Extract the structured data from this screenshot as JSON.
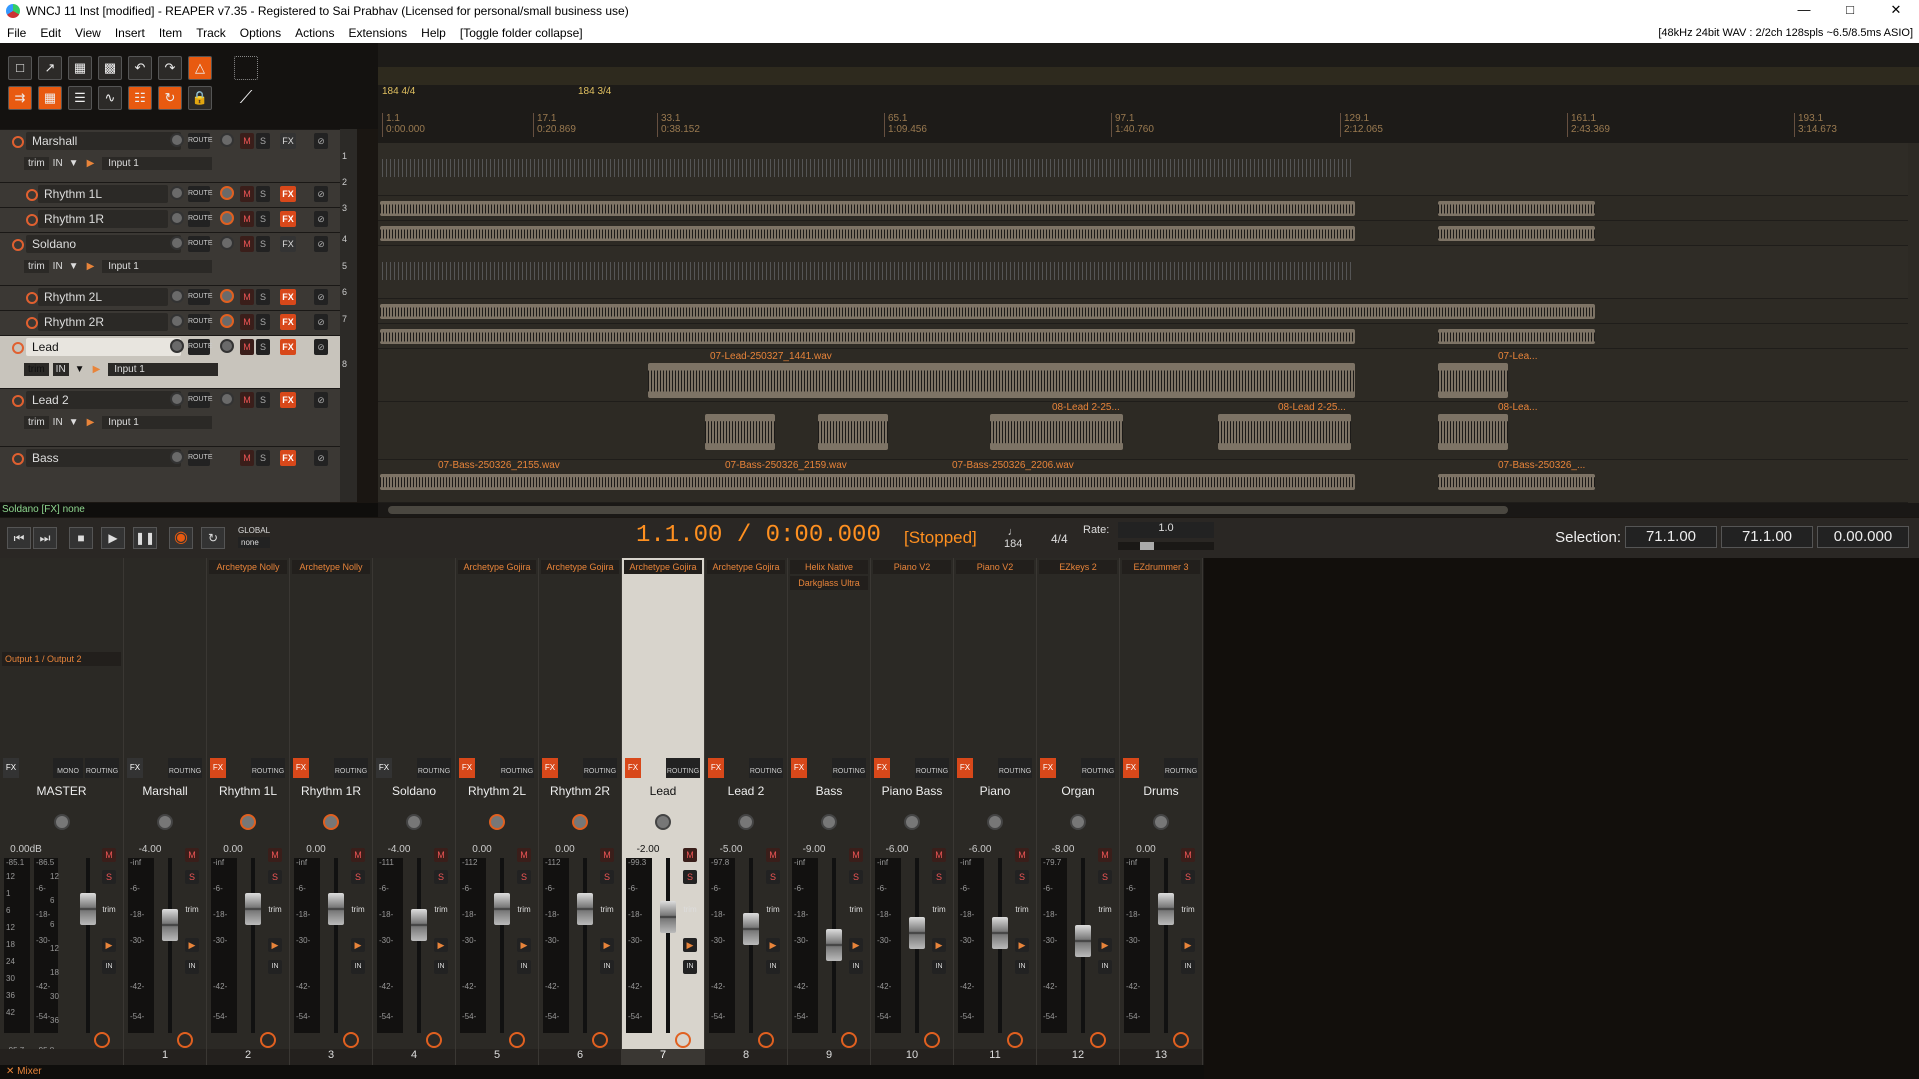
{
  "window": {
    "title": "WNCJ 11 Inst [modified] - REAPER v7.35 - Registered to Sai Prabhav (Licensed for personal/small business use)"
  },
  "menu": {
    "items": [
      "File",
      "Edit",
      "View",
      "Insert",
      "Item",
      "Track",
      "Options",
      "Actions",
      "Extensions",
      "Help",
      "[Toggle folder collapse]"
    ],
    "status": "[48kHz 24bit WAV : 2/2ch 128spls ~6.5/8.5ms ASIO]"
  },
  "ruler": {
    "regions": [
      "184 4/4",
      "184 3/4"
    ],
    "markers": [
      {
        "bar": "1.1",
        "time": "0:00.000"
      },
      {
        "bar": "17.1",
        "time": "0:20.869"
      },
      {
        "bar": "33.1",
        "time": "0:38.152"
      },
      {
        "bar": "65.1",
        "time": "1:09.456"
      },
      {
        "bar": "97.1",
        "time": "1:40.760"
      },
      {
        "bar": "129.1",
        "time": "2:12.065"
      },
      {
        "bar": "161.1",
        "time": "2:43.369"
      },
      {
        "bar": "193.1",
        "time": "3:14.673"
      }
    ]
  },
  "tracks": [
    {
      "name": "Marshall",
      "num": "1",
      "input": "Input 1"
    },
    {
      "name": "Rhythm 1L",
      "num": "2"
    },
    {
      "name": "Rhythm 1R",
      "num": "3"
    },
    {
      "name": "Soldano",
      "num": "4",
      "input": "Input 1"
    },
    {
      "name": "Rhythm 2L",
      "num": "5"
    },
    {
      "name": "Rhythm 2R",
      "num": "6"
    },
    {
      "name": "Lead",
      "num": "7",
      "input": "Input 1"
    },
    {
      "name": "Lead 2",
      "num": "8",
      "input": "Input 1"
    },
    {
      "name": "Bass",
      "num": "9"
    }
  ],
  "tcp_labels": {
    "trim": "trim",
    "in": "IN",
    "route": "ROUTE",
    "mute": "M",
    "solo": "S",
    "fx": "FX"
  },
  "items": {
    "lead": [
      "07-Lead-250327_1441.wav",
      "07-Lea..."
    ],
    "lead2": [
      "08-Lead 2-25...",
      "08-Lead 2-25...",
      "08-Lea..."
    ],
    "bass": [
      "07-Bass-250326_2155.wav",
      "07-Bass-250326_2159.wav",
      "07-Bass-250326_2206.wav",
      "07-Bass-250326_..."
    ]
  },
  "status": {
    "hover": "Soldano [FX] none"
  },
  "transport": {
    "global": "GLOBAL",
    "global_mode": "none",
    "position": "1.1.00 / 0:00.000",
    "state": "[Stopped]",
    "bpm": "184",
    "time_sig": "4/4",
    "rate_label": "Rate:",
    "rate_value": "1.0",
    "selection_label": "Selection:",
    "sel_start": "71.1.00",
    "sel_end": "71.1.00",
    "sel_len": "0.00.000"
  },
  "mixer": {
    "master_output": "Output 1 / Output 2",
    "tab_label": "Mixer",
    "fx_label": "FX",
    "routing_label": "ROUTING",
    "mono_label": "MONO",
    "trim_label": "trim",
    "in_label": "IN",
    "mute_label": "M",
    "solo_label": "S",
    "meter_marks": [
      "-6-",
      "-18-",
      "-30-",
      "-42-",
      "-54-"
    ],
    "master_left_marks": [
      "12",
      "1",
      "6",
      "12",
      "18",
      "24",
      "30",
      "36",
      "42"
    ],
    "master_right_marks": [
      "12",
      "6",
      "6",
      "12",
      "18",
      "30",
      "36"
    ],
    "master_peaks": {
      "top_l": "-85.1",
      "top_r": "-86.5",
      "bot_l": "-95.7",
      "bot_r": "-95.8"
    },
    "strips": [
      {
        "name": "MASTER",
        "num": "",
        "vol": "0.00dB",
        "peak": "",
        "fx": [],
        "fxon": false
      },
      {
        "name": "Marshall",
        "num": "1",
        "vol": "-4.00",
        "peak": "-inf",
        "fx": [],
        "fxon": false
      },
      {
        "name": "Rhythm 1L",
        "num": "2",
        "vol": "0.00",
        "peak": "-inf",
        "fx": [
          "Archetype Nolly"
        ],
        "fxon": true
      },
      {
        "name": "Rhythm 1R",
        "num": "3",
        "vol": "0.00",
        "peak": "-inf",
        "fx": [
          "Archetype Nolly"
        ],
        "fxon": true
      },
      {
        "name": "Soldano",
        "num": "4",
        "vol": "-4.00",
        "peak": "-111",
        "fx": [],
        "fxon": false
      },
      {
        "name": "Rhythm 2L",
        "num": "5",
        "vol": "0.00",
        "peak": "-112",
        "fx": [
          "Archetype Gojira"
        ],
        "fxon": true
      },
      {
        "name": "Rhythm 2R",
        "num": "6",
        "vol": "0.00",
        "peak": "-112",
        "fx": [
          "Archetype Gojira"
        ],
        "fxon": true
      },
      {
        "name": "Lead",
        "num": "7",
        "vol": "-2.00",
        "peak": "-99.3",
        "fx": [
          "Archetype Gojira"
        ],
        "fxon": true
      },
      {
        "name": "Lead 2",
        "num": "8",
        "vol": "-5.00",
        "peak": "-97.8",
        "fx": [
          "Archetype Gojira"
        ],
        "fxon": true
      },
      {
        "name": "Bass",
        "num": "9",
        "vol": "-9.00",
        "peak": "-inf",
        "fx": [
          "Helix Native",
          "Darkglass Ultra"
        ],
        "fxon": true
      },
      {
        "name": "Piano Bass",
        "num": "10",
        "vol": "-6.00",
        "peak": "-inf",
        "fx": [
          "Piano V2"
        ],
        "fxon": true
      },
      {
        "name": "Piano",
        "num": "11",
        "vol": "-6.00",
        "peak": "-inf",
        "fx": [
          "Piano V2"
        ],
        "fxon": true
      },
      {
        "name": "Organ",
        "num": "12",
        "vol": "-8.00",
        "peak": "-79.7",
        "fx": [
          "EZkeys 2"
        ],
        "fxon": true
      },
      {
        "name": "Drums",
        "num": "13",
        "vol": "0.00",
        "peak": "-inf",
        "fx": [
          "EZdrummer 3"
        ],
        "fxon": true
      }
    ]
  },
  "colors": {
    "accent": "#e8843a",
    "fx_on": "#d8481a",
    "record": "#e06020",
    "item": "#7d7365"
  }
}
